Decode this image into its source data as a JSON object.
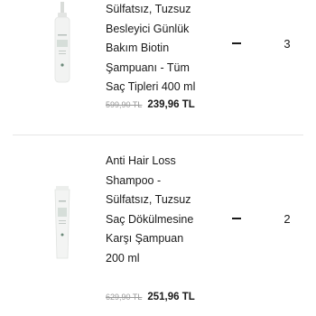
{
  "cart": {
    "items": [
      {
        "name_lines": [
          "Sülfatsız, Tuzsuz",
          "Besleyici Günlük",
          "Bakım Biotin",
          "Şampuanı - Tüm",
          "Saç Tipleri 400 ml"
        ],
        "old_price": "599,90 TL",
        "new_price": "239,96 TL",
        "quantity": "3",
        "decrease_icon": "minus-icon"
      },
      {
        "name_lines": [
          "Anti Hair Loss",
          "Shampoo -",
          "Sülfatsız, Tuzsuz",
          "Saç Dökülmesine",
          "Karşı Şampuan",
          "200 ml"
        ],
        "old_price": "629,90 TL",
        "new_price": "251,96 TL",
        "quantity": "2",
        "decrease_icon": "minus-icon"
      }
    ]
  }
}
